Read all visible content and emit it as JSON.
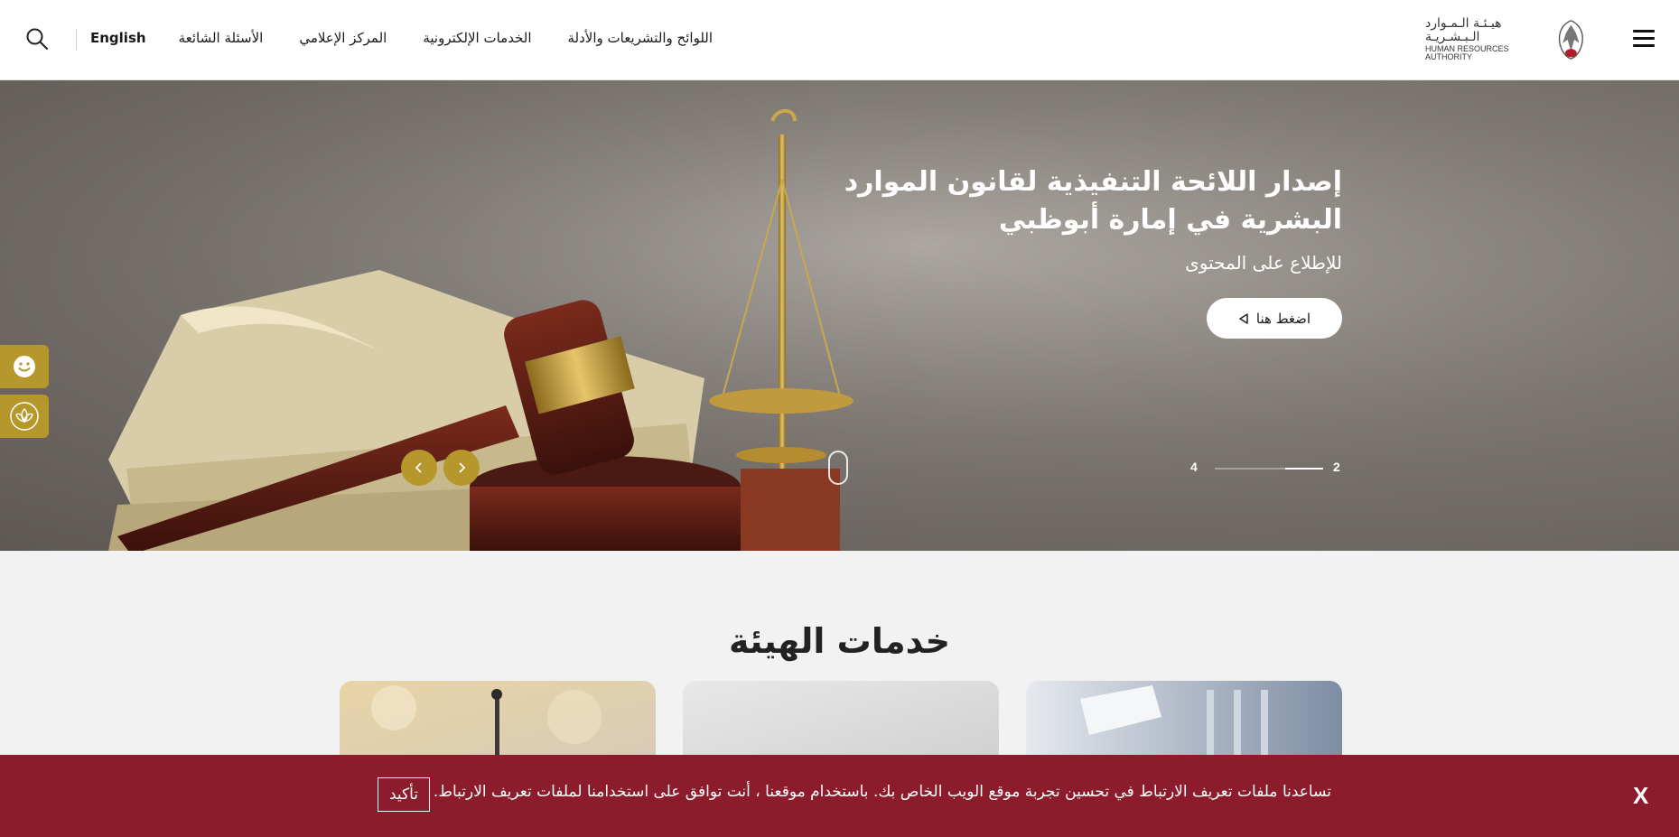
{
  "header": {
    "nav": {
      "language": "English",
      "faq": "الأسئلة الشائعة",
      "media_center": "المركز الإعلامي",
      "e_services": "الخدمات الإلكترونية",
      "regulations": "اللوائح والتشريعات والأدلة"
    },
    "logo": {
      "arabic": "هيـئـة الـمـوارد الـبـشـريـة",
      "english": "HUMAN RESOURCES AUTHORITY"
    },
    "icons": {
      "search": "search-icon",
      "menu": "hamburger-menu-icon"
    }
  },
  "hero": {
    "title": "إصدار اللائحة التنفيذية لقانون الموارد البشرية في إمارة أبوظبي",
    "subtitle": "للإطلاع على المحتوى",
    "cta_label": "اضغط هنا",
    "pager": {
      "current": "2",
      "total": "4",
      "progress": 0.25
    },
    "accent_color": "#b5972c"
  },
  "side_tools": [
    {
      "icon": "smiley-face-icon"
    },
    {
      "icon": "accessibility-flower-icon"
    }
  ],
  "services": {
    "title": "خدمات الهيئة"
  },
  "cookie_bar": {
    "message": "تساعدنا ملفات تعريف الارتباط في تحسين تجربة موقع الويب الخاص بك. باستخدام موقعنا ، أنت توافق على استخدامنا لملفات تعريف الارتباط.",
    "confirm_label": "تأكيد",
    "close_label": "X",
    "background_color": "#8c1b2c"
  }
}
